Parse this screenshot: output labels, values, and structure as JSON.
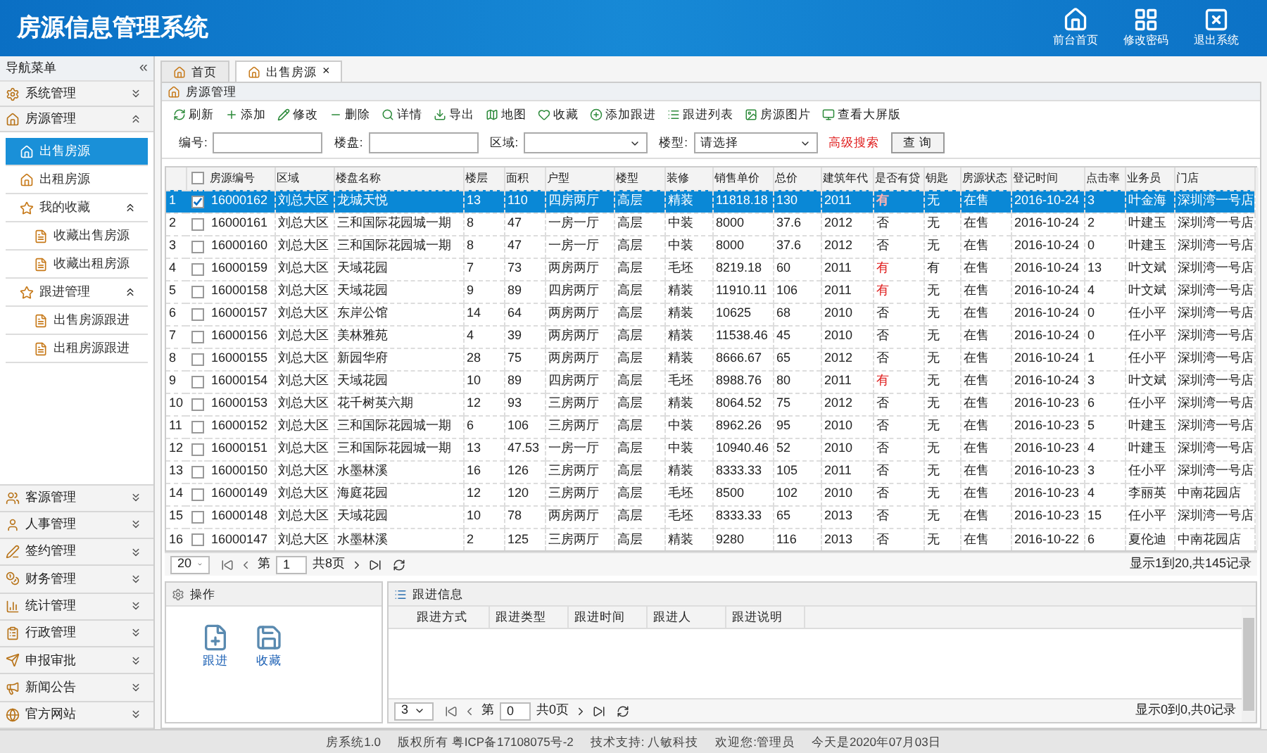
{
  "header": {
    "title": "房源信息管理系统",
    "actions": [
      {
        "label": "前台首页",
        "kind": "home"
      },
      {
        "label": "修改密码",
        "kind": "grid"
      },
      {
        "label": "退出系统",
        "kind": "exit"
      }
    ]
  },
  "sidebar": {
    "title": "导航菜单",
    "collapse": "«",
    "sections": [
      {
        "label": "系统管理",
        "expanded": false
      },
      {
        "label": "房源管理",
        "expanded": true,
        "items": [
          {
            "label": "出售房源",
            "selected": true
          },
          {
            "label": "出租房源",
            "selected": false
          },
          {
            "label": "我的收藏",
            "selected": false,
            "expanded": true,
            "children": [
              {
                "label": "收藏出售房源",
                "selected": false
              },
              {
                "label": "收藏出租房源",
                "selected": false
              }
            ]
          },
          {
            "label": "跟进管理",
            "selected": false,
            "expanded": true,
            "children": [
              {
                "label": "出售房源跟进",
                "selected": false
              },
              {
                "label": "出租房源跟进",
                "selected": false
              }
            ]
          }
        ]
      },
      {
        "label": "客源管理",
        "expanded": false
      },
      {
        "label": "人事管理",
        "expanded": false
      },
      {
        "label": "签约管理",
        "expanded": false
      },
      {
        "label": "财务管理",
        "expanded": false
      },
      {
        "label": "统计管理",
        "expanded": false
      },
      {
        "label": "行政管理",
        "expanded": false
      },
      {
        "label": "申报审批",
        "expanded": false
      },
      {
        "label": "新闻公告",
        "expanded": false
      },
      {
        "label": "官方网站",
        "expanded": false
      }
    ]
  },
  "tabs": [
    {
      "label": "首页",
      "selected": false,
      "closable": false
    },
    {
      "label": "出售房源",
      "selected": true,
      "closable": true,
      "close": "×"
    }
  ],
  "panel_title": "房源管理",
  "toolbar": [
    {
      "label": "刷新"
    },
    {
      "label": "添加"
    },
    {
      "label": "修改"
    },
    {
      "label": "删除"
    },
    {
      "label": "详情"
    },
    {
      "label": "导出"
    },
    {
      "label": "地图"
    },
    {
      "label": "收藏"
    },
    {
      "label": "添加跟进"
    },
    {
      "label": "跟进列表"
    },
    {
      "label": "房源图片"
    },
    {
      "label": "查看大屏版"
    }
  ],
  "search": {
    "fields": [
      {
        "label": "编号:",
        "kind": "text"
      },
      {
        "label": "楼盘:",
        "kind": "text"
      },
      {
        "label": "区域:",
        "kind": "select"
      },
      {
        "label": "楼型:",
        "kind": "select",
        "value": "请选择"
      }
    ],
    "advanced": "高级搜索",
    "button": "查 询"
  },
  "table": {
    "all_checked": false,
    "columns": [
      "房源编号",
      "区域",
      "楼盘名称",
      "楼层",
      "面积",
      "户型",
      "楼型",
      "装修",
      "销售单价",
      "总价",
      "建筑年代",
      "是否有贷",
      "钥匙",
      "房源状态",
      "登记时间",
      "点击率",
      "业务员",
      "门店"
    ],
    "rows": [
      {
        "num": "1",
        "selected": true,
        "checked": true,
        "has_loan": true,
        "cells": [
          "16000162",
          "刘总大区",
          "龙城天悦",
          "13",
          "110",
          "四房两厅",
          "高层",
          "精装",
          "11818.18",
          "130",
          "2011",
          "有",
          "无",
          "在售",
          "2016-10-24",
          "3",
          "叶金海",
          "深圳湾一号店"
        ]
      },
      {
        "num": "2",
        "selected": false,
        "checked": false,
        "has_loan": false,
        "cells": [
          "16000161",
          "刘总大区",
          "三和国际花园城一期",
          "8",
          "47",
          "一房一厅",
          "高层",
          "中装",
          "8000",
          "37.6",
          "2012",
          "否",
          "无",
          "在售",
          "2016-10-24",
          "2",
          "叶建玉",
          "深圳湾一号店"
        ]
      },
      {
        "num": "3",
        "selected": false,
        "checked": false,
        "has_loan": false,
        "cells": [
          "16000160",
          "刘总大区",
          "三和国际花园城一期",
          "8",
          "47",
          "一房一厅",
          "高层",
          "中装",
          "8000",
          "37.6",
          "2012",
          "否",
          "无",
          "在售",
          "2016-10-24",
          "0",
          "叶建玉",
          "深圳湾一号店"
        ]
      },
      {
        "num": "4",
        "selected": false,
        "checked": false,
        "has_loan": true,
        "cells": [
          "16000159",
          "刘总大区",
          "天域花园",
          "7",
          "73",
          "两房两厅",
          "高层",
          "毛坯",
          "8219.18",
          "60",
          "2011",
          "有",
          "有",
          "在售",
          "2016-10-24",
          "13",
          "叶文斌",
          "深圳湾一号店"
        ]
      },
      {
        "num": "5",
        "selected": false,
        "checked": false,
        "has_loan": true,
        "cells": [
          "16000158",
          "刘总大区",
          "天域花园",
          "9",
          "89",
          "四房两厅",
          "高层",
          "精装",
          "11910.11",
          "106",
          "2011",
          "有",
          "无",
          "在售",
          "2016-10-24",
          "4",
          "叶文斌",
          "深圳湾一号店"
        ]
      },
      {
        "num": "6",
        "selected": false,
        "checked": false,
        "has_loan": false,
        "cells": [
          "16000157",
          "刘总大区",
          "东岸公馆",
          "14",
          "64",
          "两房两厅",
          "高层",
          "精装",
          "10625",
          "68",
          "2010",
          "否",
          "无",
          "在售",
          "2016-10-24",
          "0",
          "任小平",
          "深圳湾一号店"
        ]
      },
      {
        "num": "7",
        "selected": false,
        "checked": false,
        "has_loan": false,
        "cells": [
          "16000156",
          "刘总大区",
          "美林雅苑",
          "4",
          "39",
          "两房两厅",
          "高层",
          "精装",
          "11538.46",
          "45",
          "2010",
          "否",
          "无",
          "在售",
          "2016-10-24",
          "0",
          "任小平",
          "深圳湾一号店"
        ]
      },
      {
        "num": "8",
        "selected": false,
        "checked": false,
        "has_loan": false,
        "cells": [
          "16000155",
          "刘总大区",
          "新园华府",
          "28",
          "75",
          "两房两厅",
          "高层",
          "精装",
          "8666.67",
          "65",
          "2012",
          "否",
          "无",
          "在售",
          "2016-10-24",
          "1",
          "任小平",
          "深圳湾一号店"
        ]
      },
      {
        "num": "9",
        "selected": false,
        "checked": false,
        "has_loan": true,
        "cells": [
          "16000154",
          "刘总大区",
          "天域花园",
          "10",
          "89",
          "四房两厅",
          "高层",
          "毛坯",
          "8988.76",
          "80",
          "2011",
          "有",
          "无",
          "在售",
          "2016-10-24",
          "3",
          "叶文斌",
          "深圳湾一号店"
        ]
      },
      {
        "num": "10",
        "selected": false,
        "checked": false,
        "has_loan": false,
        "cells": [
          "16000153",
          "刘总大区",
          "花千树英六期",
          "12",
          "93",
          "三房两厅",
          "高层",
          "精装",
          "8064.52",
          "75",
          "2012",
          "否",
          "无",
          "在售",
          "2016-10-23",
          "6",
          "任小平",
          "深圳湾一号店"
        ]
      },
      {
        "num": "11",
        "selected": false,
        "checked": false,
        "has_loan": false,
        "cells": [
          "16000152",
          "刘总大区",
          "三和国际花园城一期",
          "6",
          "106",
          "三房两厅",
          "高层",
          "中装",
          "8962.26",
          "95",
          "2010",
          "否",
          "无",
          "在售",
          "2016-10-23",
          "5",
          "叶建玉",
          "深圳湾一号店"
        ]
      },
      {
        "num": "12",
        "selected": false,
        "checked": false,
        "has_loan": false,
        "cells": [
          "16000151",
          "刘总大区",
          "三和国际花园城一期",
          "13",
          "47.53",
          "一房一厅",
          "高层",
          "中装",
          "10940.46",
          "52",
          "2010",
          "否",
          "无",
          "在售",
          "2016-10-23",
          "4",
          "叶建玉",
          "深圳湾一号店"
        ]
      },
      {
        "num": "13",
        "selected": false,
        "checked": false,
        "has_loan": false,
        "cells": [
          "16000150",
          "刘总大区",
          "水墨林溪",
          "16",
          "126",
          "三房两厅",
          "高层",
          "精装",
          "8333.33",
          "105",
          "2011",
          "否",
          "无",
          "在售",
          "2016-10-23",
          "3",
          "任小平",
          "深圳湾一号店"
        ]
      },
      {
        "num": "14",
        "selected": false,
        "checked": false,
        "has_loan": false,
        "cells": [
          "16000149",
          "刘总大区",
          "海庭花园",
          "12",
          "120",
          "三房两厅",
          "高层",
          "毛坯",
          "8500",
          "102",
          "2010",
          "否",
          "无",
          "在售",
          "2016-10-23",
          "4",
          "李丽英",
          "中南花园店"
        ]
      },
      {
        "num": "15",
        "selected": false,
        "checked": false,
        "has_loan": false,
        "cells": [
          "16000148",
          "刘总大区",
          "天域花园",
          "10",
          "78",
          "两房两厅",
          "高层",
          "毛坯",
          "8333.33",
          "65",
          "2013",
          "否",
          "无",
          "在售",
          "2016-10-23",
          "15",
          "任小平",
          "深圳湾一号店"
        ]
      },
      {
        "num": "16",
        "selected": false,
        "checked": false,
        "has_loan": false,
        "cells": [
          "16000147",
          "刘总大区",
          "水墨林溪",
          "2",
          "125",
          "三房两厅",
          "高层",
          "精装",
          "9280",
          "116",
          "2013",
          "否",
          "无",
          "在售",
          "2016-10-22",
          "6",
          "夏伦迪",
          "中南花园店"
        ]
      }
    ]
  },
  "pager": {
    "page_size": "20",
    "page_label": "第",
    "page": "1",
    "pages": "共8页",
    "summary": "显示1到20,共145记录"
  },
  "ops_panel": {
    "title": "操作",
    "buttons": [
      {
        "label": "跟进",
        "kind": "add"
      },
      {
        "label": "收藏",
        "kind": "save"
      }
    ]
  },
  "follow_panel": {
    "title": "跟进信息",
    "columns": [
      "跟进方式",
      "跟进类型",
      "跟进时间",
      "跟进人",
      "跟进说明"
    ],
    "pager": {
      "page_size": "3",
      "page_label": "第",
      "page": "0",
      "pages": "共0页",
      "summary": "显示0到0,共0记录"
    }
  },
  "footer": [
    "房系统1.0",
    "版权所有 粤ICP备17108075号-2",
    "技术支持: 八敏科技",
    "欢迎您:管理员",
    "今天是2020年07月03日"
  ]
}
